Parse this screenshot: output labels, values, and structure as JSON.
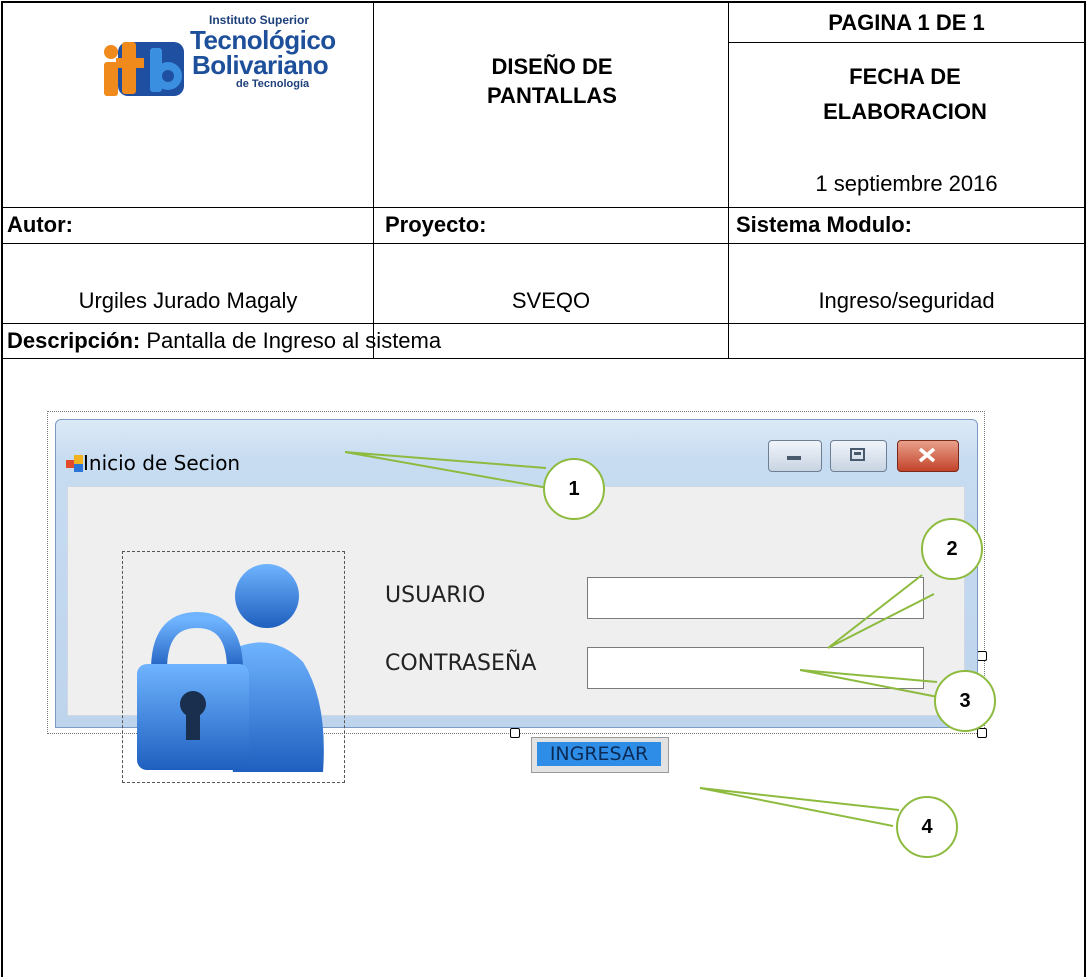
{
  "logo": {
    "line1": "Instituto Superior",
    "line2": "Tecnológico",
    "line3": "Bolivariano",
    "line4": "de Tecnología",
    "mark": "itb"
  },
  "header": {
    "title": "DISEÑO DE PANTALLAS",
    "page": "PAGINA 1 DE 1",
    "date_label": "FECHA DE ELABORACION",
    "date_value": "1 septiembre 2016"
  },
  "meta": {
    "author_label": "Autor:",
    "author_value": "Urgiles Jurado Magaly",
    "project_label": "Proyecto:",
    "project_value": "SVEQO",
    "module_label": "Sistema Modulo:",
    "module_value": "Ingreso/seguridad"
  },
  "description": {
    "label": "Descripción:",
    "text": " Pantalla de Ingreso al sistema"
  },
  "window": {
    "title": "Inicio de Secion",
    "user_label": "USUARIO",
    "password_label": "CONTRASEÑA",
    "login_button": "INGRESAR",
    "user_value": "",
    "password_value": "",
    "icons": [
      "app-icon",
      "minimize-icon",
      "maximize-icon",
      "close-icon",
      "lock-user-icon"
    ]
  },
  "callouts": [
    "1",
    "2",
    "3",
    "4"
  ],
  "colors": {
    "callout_border": "#8dbb3f",
    "button_fill": "#2e8de6",
    "icon_blue": "#3b8ee8"
  }
}
